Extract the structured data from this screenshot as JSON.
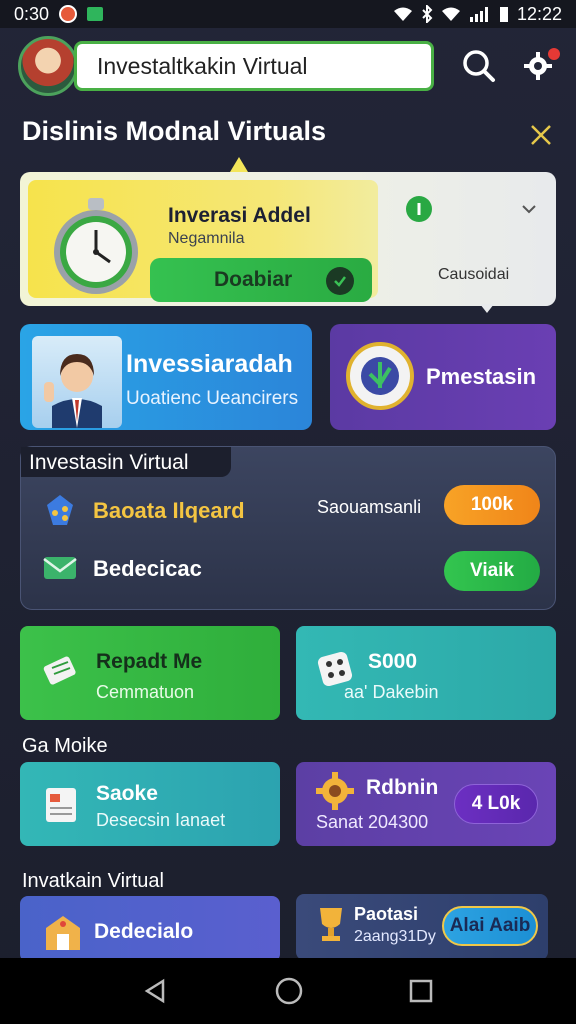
{
  "status_bar": {
    "time": "0:30",
    "clock": "12:22"
  },
  "header": {
    "search_text": "Investaltkakin Virtual"
  },
  "section": {
    "title": "Dislinis Modnal Virtuals"
  },
  "hero": {
    "title": "Inverasi Addel",
    "subtitle": "Negamnila",
    "button_label": "Doabiar",
    "side_label": "Causoidai"
  },
  "promo_cards": {
    "blue": {
      "title": "Invessiaradah",
      "subtitle": "Uoatienc Ueancirers"
    },
    "purple": {
      "title": "Pmestasin"
    }
  },
  "virtual_panel": {
    "title": "Investasin Virtual",
    "rows": [
      {
        "label": "Baoata Ilqeard",
        "middle": "Saouamsanli",
        "action": "100k",
        "icon": "share-icon",
        "label_color": "#f4c542",
        "action_color": "#f29a1a"
      },
      {
        "label": "Bedecicac",
        "middle": "",
        "action": "Viaik",
        "icon": "mail-icon",
        "label_color": "#ffffff",
        "action_color": "#2ebd4f"
      }
    ]
  },
  "grid": {
    "row1": [
      {
        "title": "Repadt Me",
        "subtitle": "Cemmatuon",
        "icon": "ticket-icon"
      },
      {
        "title": "S000",
        "subtitle": "aa' Dakebin",
        "icon": "dice-icon"
      }
    ],
    "label2": "Ga Moike",
    "row2": [
      {
        "title": "Saoke",
        "subtitle": "Desecsin Ianaet",
        "icon": "document-icon"
      },
      {
        "title": "Rdbnin",
        "subtitle": "Sanat 204300",
        "icon": "gear-gold-icon",
        "pill": "4 L0k"
      }
    ],
    "label3": "Invatkain Virtual",
    "row3": [
      {
        "title": "Dedecialo",
        "subtitle": "",
        "icon": "building-icon"
      },
      {
        "title": "Paotasi",
        "subtitle": "2aang31Dy",
        "icon": "trophy-icon",
        "pill": "Alai Aaib"
      }
    ]
  }
}
